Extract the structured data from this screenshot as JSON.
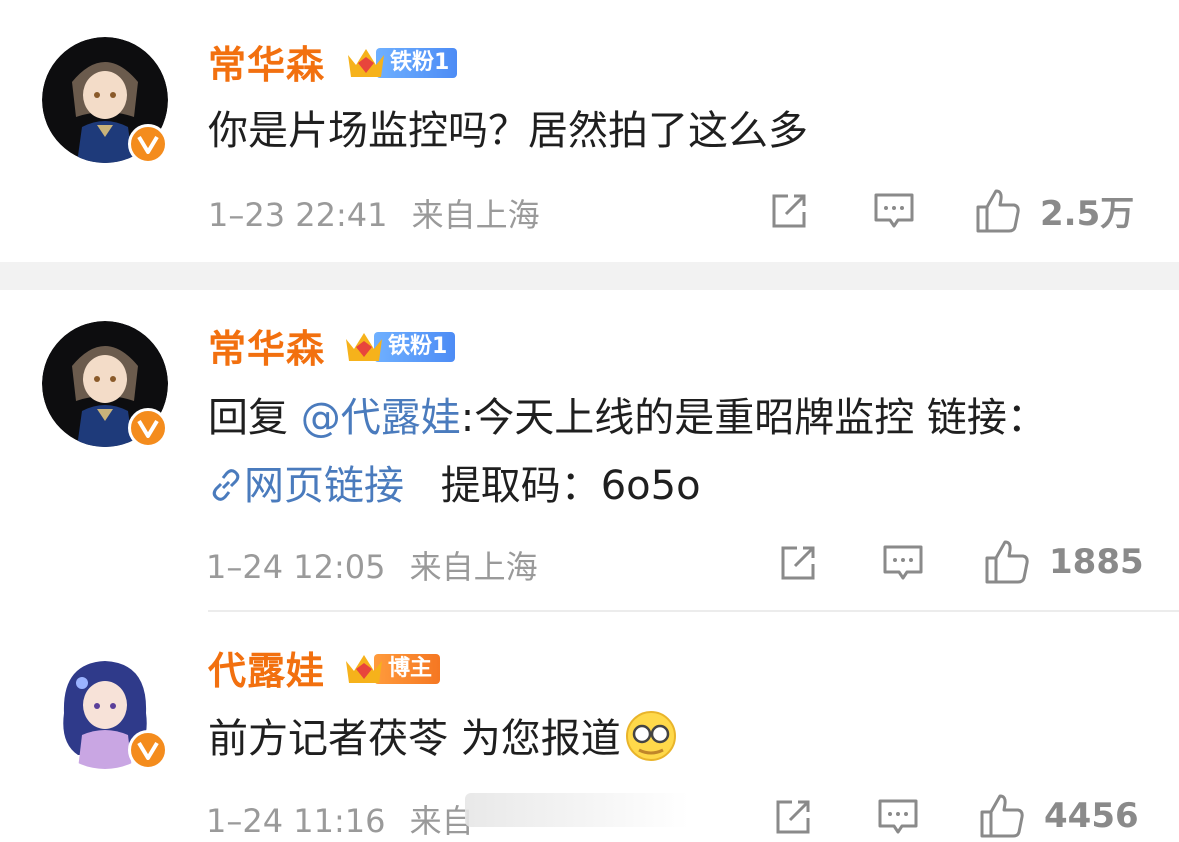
{
  "comments": [
    {
      "username": "常华森",
      "badge": "铁粉1",
      "text": "你是片场监控吗？居然拍了这么多",
      "time": "1–23 22:41",
      "location": "来自上海",
      "likes": "2.5万"
    },
    {
      "username": "常华森",
      "badge": "铁粉1",
      "reply_prefix": "回复",
      "mention": "@代露娃",
      "text": ":今天上线的是重昭牌监控 链接：",
      "link_text": "网页链接",
      "code_text": "提取码：6o5o",
      "time": "1–24 12:05",
      "location": "来自上海",
      "likes": "1885"
    },
    {
      "username": "代露娃",
      "badge": "博主",
      "text": "前方记者茯苓 为您报道",
      "time": "1–24 11:16",
      "location": "来自",
      "likes": "4456"
    }
  ],
  "colors": {
    "username": "#f2700f",
    "link": "#4a7bbd",
    "meta": "#9a9a9a",
    "fan_badge": "#4d8cf5",
    "host_badge": "#f57722"
  },
  "icons": [
    "share-icon",
    "comment-icon",
    "like-icon",
    "verified-v-icon",
    "crown-icon",
    "link-icon",
    "emoji-glasses-icon"
  ]
}
